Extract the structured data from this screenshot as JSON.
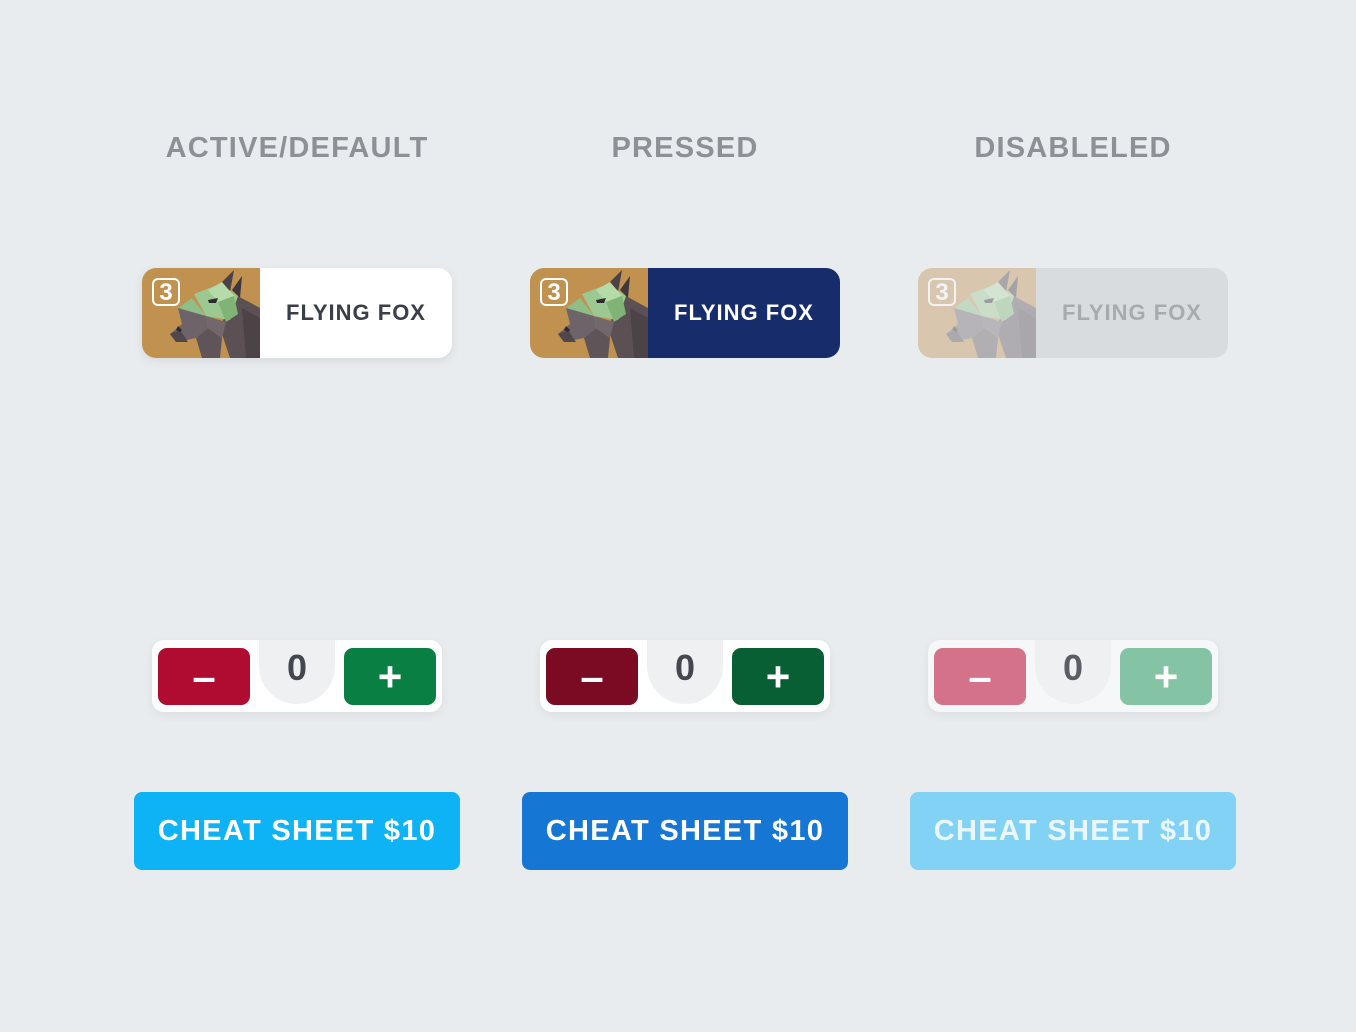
{
  "headings": {
    "active": "ACTIVE/DEFAULT",
    "pressed": "PRESSED",
    "disabled": "DISABLELED"
  },
  "runner": {
    "number": "3",
    "name": "FLYING FOX",
    "silk_color": "#c1914f",
    "icon": "horse-head-icon",
    "pressed_background": "#172c6a"
  },
  "stepper": {
    "minus_label": "–",
    "plus_label": "+",
    "value": "0",
    "minus_color": "#b00c31",
    "plus_color": "#0a7f44"
  },
  "cta": {
    "label": "CHEAT SHEET $10",
    "active_color": "#0db3f5",
    "pressed_color": "#1577d3",
    "disabled_color": "#82d2f6"
  }
}
